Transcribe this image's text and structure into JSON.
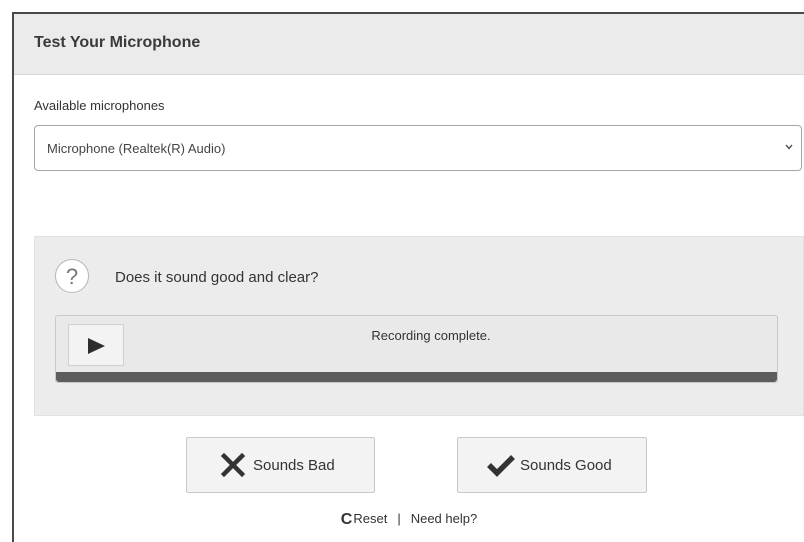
{
  "header": {
    "title": "Test Your Microphone"
  },
  "microphone": {
    "label": "Available microphones",
    "selected": "Microphone (Realtek(R) Audio)",
    "chevron_icon": "chevron-down-icon"
  },
  "test": {
    "question": "Does it sound good and clear?",
    "question_icon": "question-mark-icon",
    "question_glyph": "?",
    "player": {
      "status": "Recording complete.",
      "play_icon": "play-icon",
      "progress": 1.0
    }
  },
  "actions": {
    "bad_label": "Sounds Bad",
    "bad_icon": "x-icon",
    "good_label": "Sounds Good",
    "good_icon": "checkmark-icon"
  },
  "footer": {
    "reset_glyph": "C",
    "reset_label": "Reset",
    "separator": "|",
    "help_label": "Need help?"
  },
  "colors": {
    "header_bg": "#ebebeb",
    "panel_bg": "#ececec",
    "progress_fill": "#5d5d5d",
    "icon_dark": "#333333"
  }
}
